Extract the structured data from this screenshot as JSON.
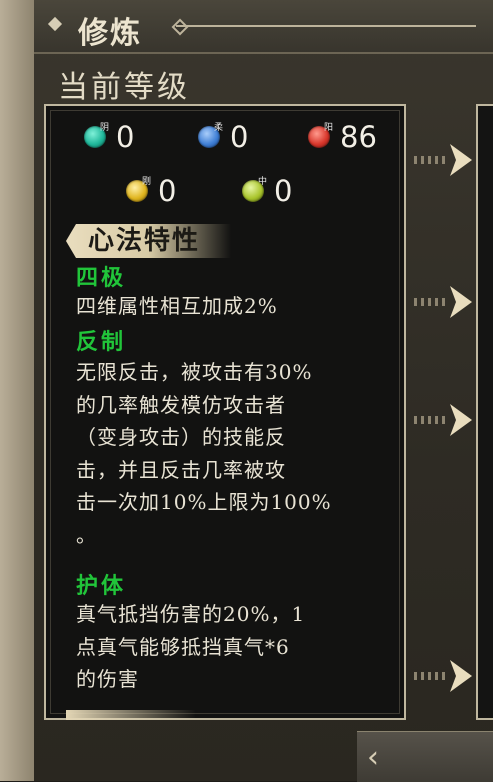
{
  "header": {
    "title": "修炼"
  },
  "section": {
    "level_label": "当前等级"
  },
  "elements": [
    {
      "tag": "阴",
      "value": "0",
      "color": "#1fb79a"
    },
    {
      "tag": "柔",
      "value": "0",
      "color": "#3f7fd6"
    },
    {
      "tag": "阳",
      "value": "86",
      "color": "#d8362b"
    },
    {
      "tag": "刚",
      "value": "0",
      "color": "#e0b51f"
    },
    {
      "tag": "中",
      "value": "0",
      "color": "#a9c52c"
    }
  ],
  "traits": {
    "header": "心法特性",
    "items": [
      {
        "name": "四极",
        "desc": "四维属性相互加成2%"
      },
      {
        "name": "反制",
        "desc": "无限反击，被攻击有30%\n的几率触发模仿攻击者\n（变身攻击）的技能反\n击，并且反击几率被攻\n击一次加10%上限为100%\n。"
      },
      {
        "name": "护体",
        "desc": "真气抵挡伤害的20%，1\n点真气能够抵挡真气*6\n的伤害"
      }
    ]
  }
}
